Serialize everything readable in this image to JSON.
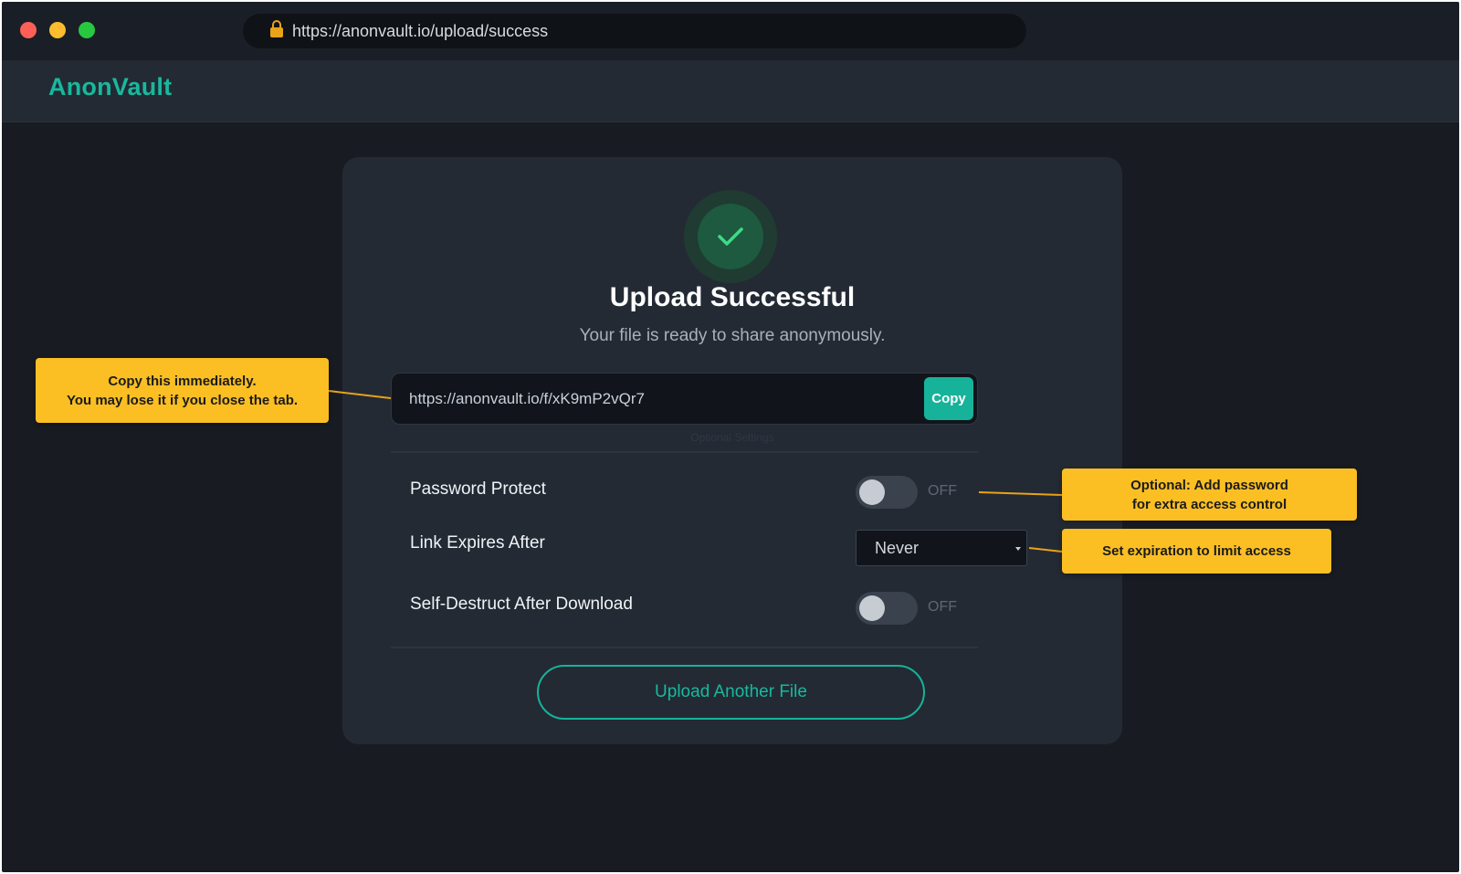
{
  "browser": {
    "url": "https://anonvault.io/upload/success"
  },
  "header": {
    "brand": "AnonVault"
  },
  "card": {
    "title": "Upload Successful",
    "subtitle": "Your file is ready to share anonymously.",
    "share_link": "https://anonvault.io/f/xK9mP2vQr7",
    "copy_label": "Copy",
    "section_label": "Optional Settings",
    "settings": {
      "password": {
        "label": "Password Protect",
        "state": "OFF"
      },
      "expires": {
        "label": "Link Expires After",
        "selected": "Never"
      },
      "self_destruct": {
        "label": "Self-Destruct After Download",
        "state": "OFF"
      }
    },
    "upload_another_label": "Upload Another File"
  },
  "callouts": {
    "copy": {
      "line1": "Copy this immediately.",
      "line2": "You may lose it if you close the tab."
    },
    "password": {
      "line1": "Optional: Add password",
      "line2": "for extra access control"
    },
    "expiry": {
      "line1": "Set expiration to limit access"
    }
  },
  "colors": {
    "accent": "#16b39a",
    "callout": "#fbbf24",
    "background": "#181c22",
    "card": "#232a34"
  }
}
